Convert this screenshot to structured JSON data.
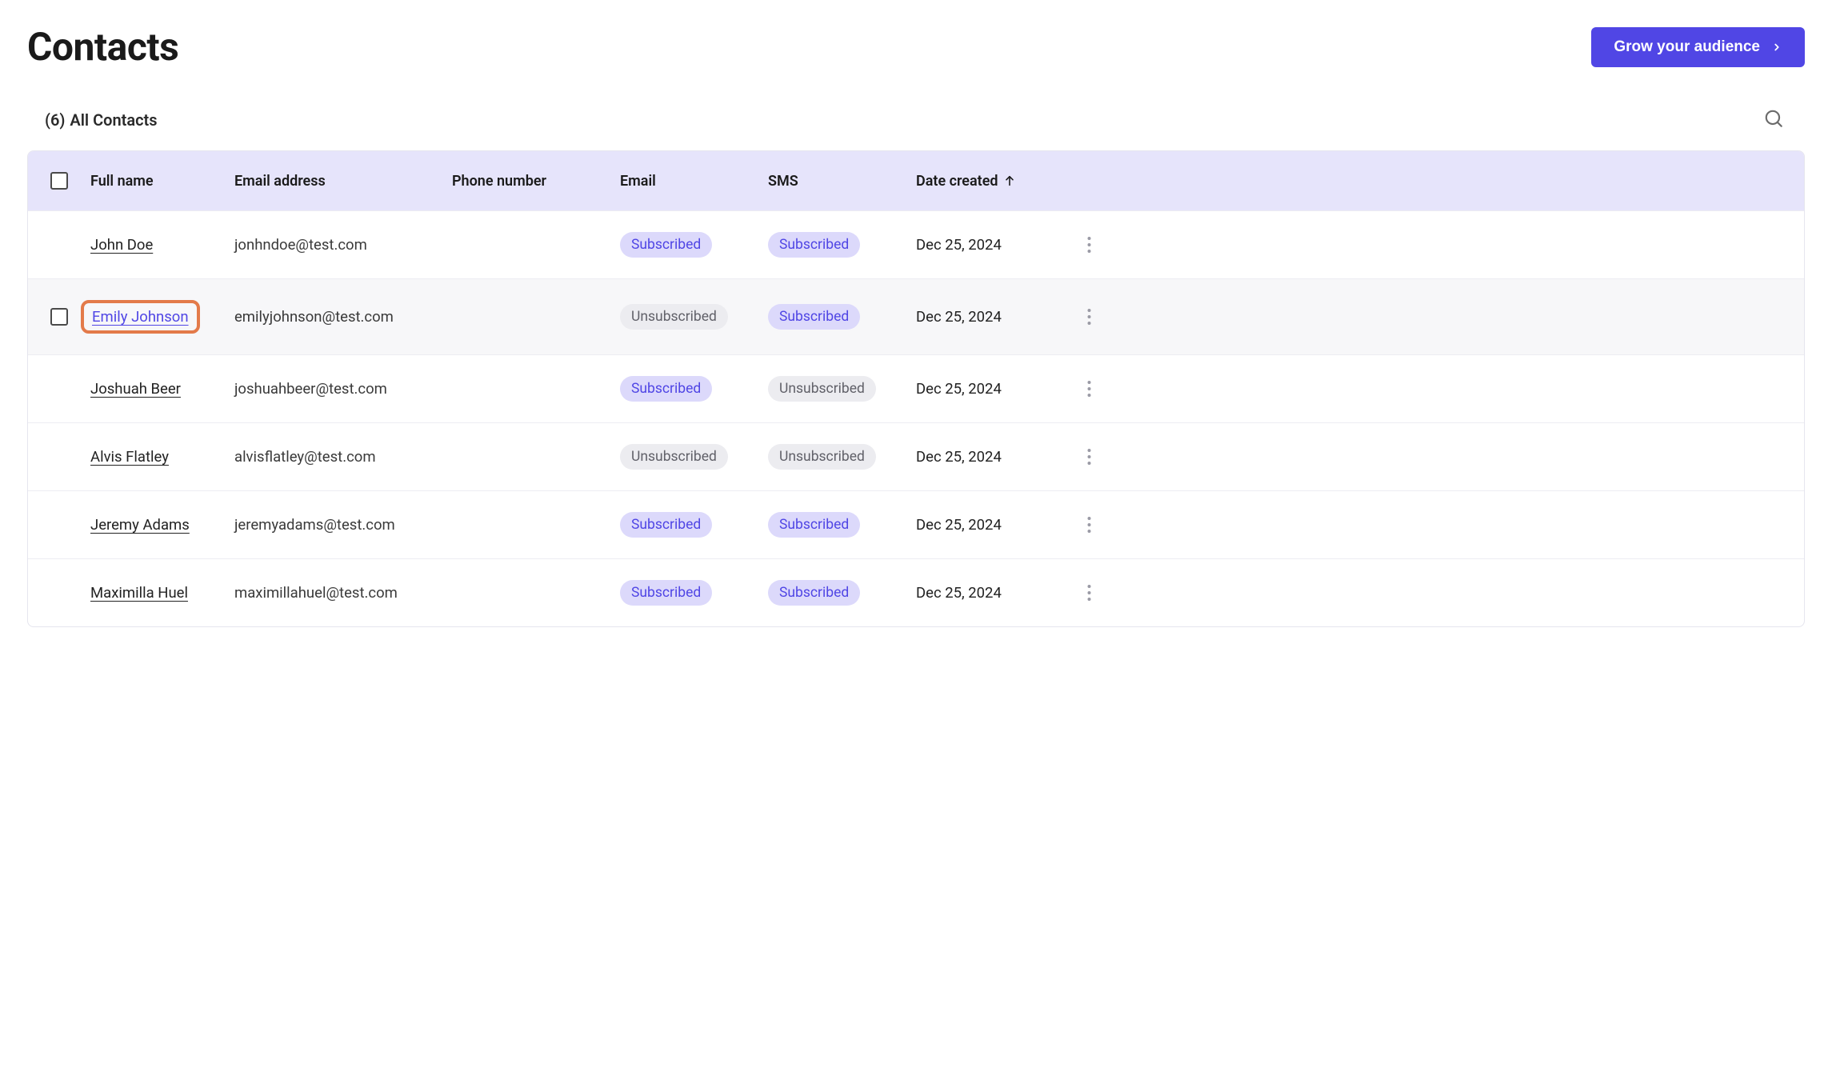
{
  "header": {
    "title": "Contacts",
    "cta_label": "Grow your audience"
  },
  "subheader": {
    "count_label": "(6)",
    "filter_label": "All Contacts"
  },
  "table": {
    "columns": {
      "full_name": "Full name",
      "email": "Email address",
      "phone": "Phone number",
      "email_status": "Email",
      "sms_status": "SMS",
      "date_created": "Date created"
    },
    "sort_column": "date_created",
    "sort_dir": "asc",
    "status_labels": {
      "subscribed": "Subscribed",
      "unsubscribed": "Unsubscribed"
    },
    "rows": [
      {
        "name": "John Doe",
        "email": "jonhndoe@test.com",
        "phone": "",
        "email_status": "subscribed",
        "sms_status": "subscribed",
        "date": "Dec 25, 2024",
        "highlighted": false,
        "callout": false
      },
      {
        "name": "Emily Johnson",
        "email": "emilyjohnson@test.com",
        "phone": "",
        "email_status": "unsubscribed",
        "sms_status": "subscribed",
        "date": "Dec 25, 2024",
        "highlighted": true,
        "callout": true
      },
      {
        "name": "Joshuah Beer",
        "email": "joshuahbeer@test.com",
        "phone": "",
        "email_status": "subscribed",
        "sms_status": "unsubscribed",
        "date": "Dec 25, 2024",
        "highlighted": false,
        "callout": false
      },
      {
        "name": "Alvis Flatley",
        "email": "alvisflatley@test.com",
        "phone": "",
        "email_status": "unsubscribed",
        "sms_status": "unsubscribed",
        "date": "Dec 25, 2024",
        "highlighted": false,
        "callout": false
      },
      {
        "name": "Jeremy Adams",
        "email": "jeremyadams@test.com",
        "phone": "",
        "email_status": "subscribed",
        "sms_status": "subscribed",
        "date": "Dec 25, 2024",
        "highlighted": false,
        "callout": false
      },
      {
        "name": "Maximilla Huel",
        "email": "maximillahuel@test.com",
        "phone": "",
        "email_status": "subscribed",
        "sms_status": "subscribed",
        "date": "Dec 25, 2024",
        "highlighted": false,
        "callout": false
      }
    ]
  }
}
